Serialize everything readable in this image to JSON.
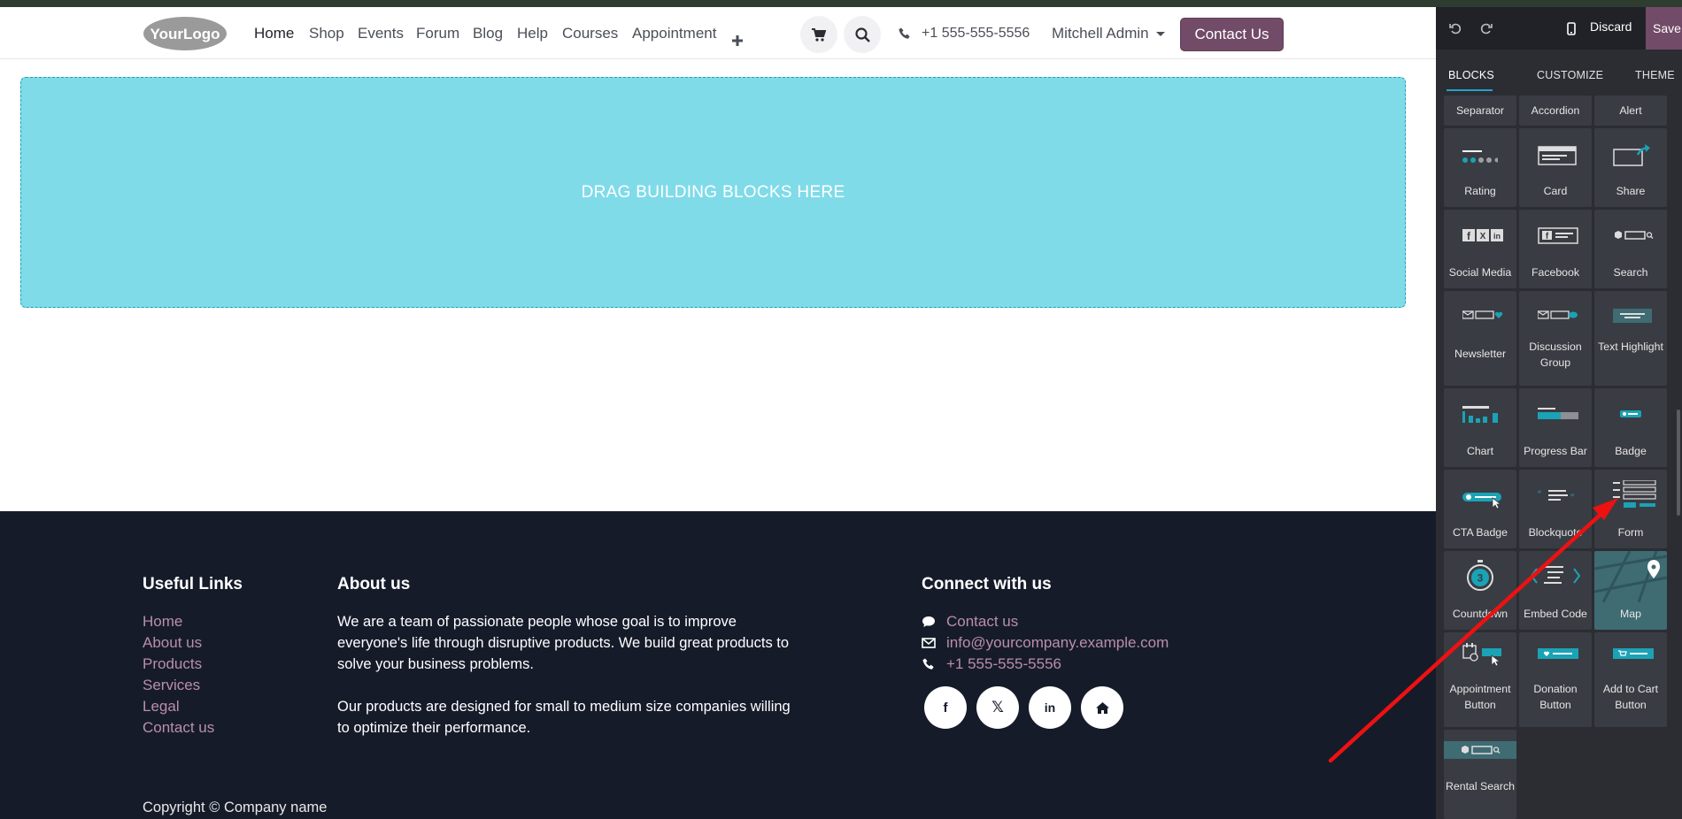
{
  "navbar": {
    "logo_text": "YourLogo",
    "menu": [
      {
        "label": "Home",
        "active": true
      },
      {
        "label": "Shop"
      },
      {
        "label": "Events"
      },
      {
        "label": "Forum"
      },
      {
        "label": "Blog"
      },
      {
        "label": "Help"
      },
      {
        "label": "Courses"
      },
      {
        "label": "Appointment"
      }
    ],
    "add_icon": "plus-icon",
    "cart_icon": "cart-icon",
    "search_icon": "search-icon",
    "phone": "+1 555-555-5556",
    "user": "Mitchell Admin",
    "contact_button": "Contact Us",
    "accent_color": "#714b67"
  },
  "dropzone": {
    "text": "DRAG BUILDING BLOCKS HERE",
    "color": "#80dbe9"
  },
  "footer": {
    "useful_links": {
      "heading": "Useful Links",
      "links": [
        "Home",
        "About us",
        "Products",
        "Services",
        "Legal",
        "Contact us"
      ]
    },
    "about": {
      "heading": "About us",
      "paragraph1": "We are a team of passionate people whose goal is to improve everyone's life through disruptive products. We build great products to solve your business problems.",
      "paragraph2": "Our products are designed for small to medium size companies willing to optimize their performance."
    },
    "connect": {
      "heading": "Connect with us",
      "contact_link": "Contact us",
      "email": "info@yourcompany.example.com",
      "phone": "+1 555-555-5556",
      "social": [
        "facebook-icon",
        "x-icon",
        "linkedin-icon",
        "home-icon"
      ]
    },
    "copyright": "Copyright © Company name",
    "link_color": "#b98eae",
    "background": "#161b2a"
  },
  "panel": {
    "discard": "Discard",
    "save": "Save",
    "tabs": [
      "BLOCKS",
      "CUSTOMIZE",
      "THEME"
    ],
    "active_tab": "BLOCKS",
    "blocks": [
      [
        "Separator",
        "Accordion",
        "Alert"
      ],
      [
        "Rating",
        "Card",
        "Share"
      ],
      [
        "Social Media",
        "Facebook",
        "Search"
      ],
      [
        "Newsletter",
        "Discussion Group",
        "Text Highlight"
      ],
      [
        "Chart",
        "Progress Bar",
        "Badge"
      ],
      [
        "CTA Badge",
        "Blockquote",
        "Form"
      ],
      [
        "Countdown",
        "Embed Code",
        "Map"
      ],
      [
        "Appointment Button",
        "Donation Button",
        "Add to Cart Button"
      ],
      [
        "Rental Search"
      ]
    ]
  }
}
